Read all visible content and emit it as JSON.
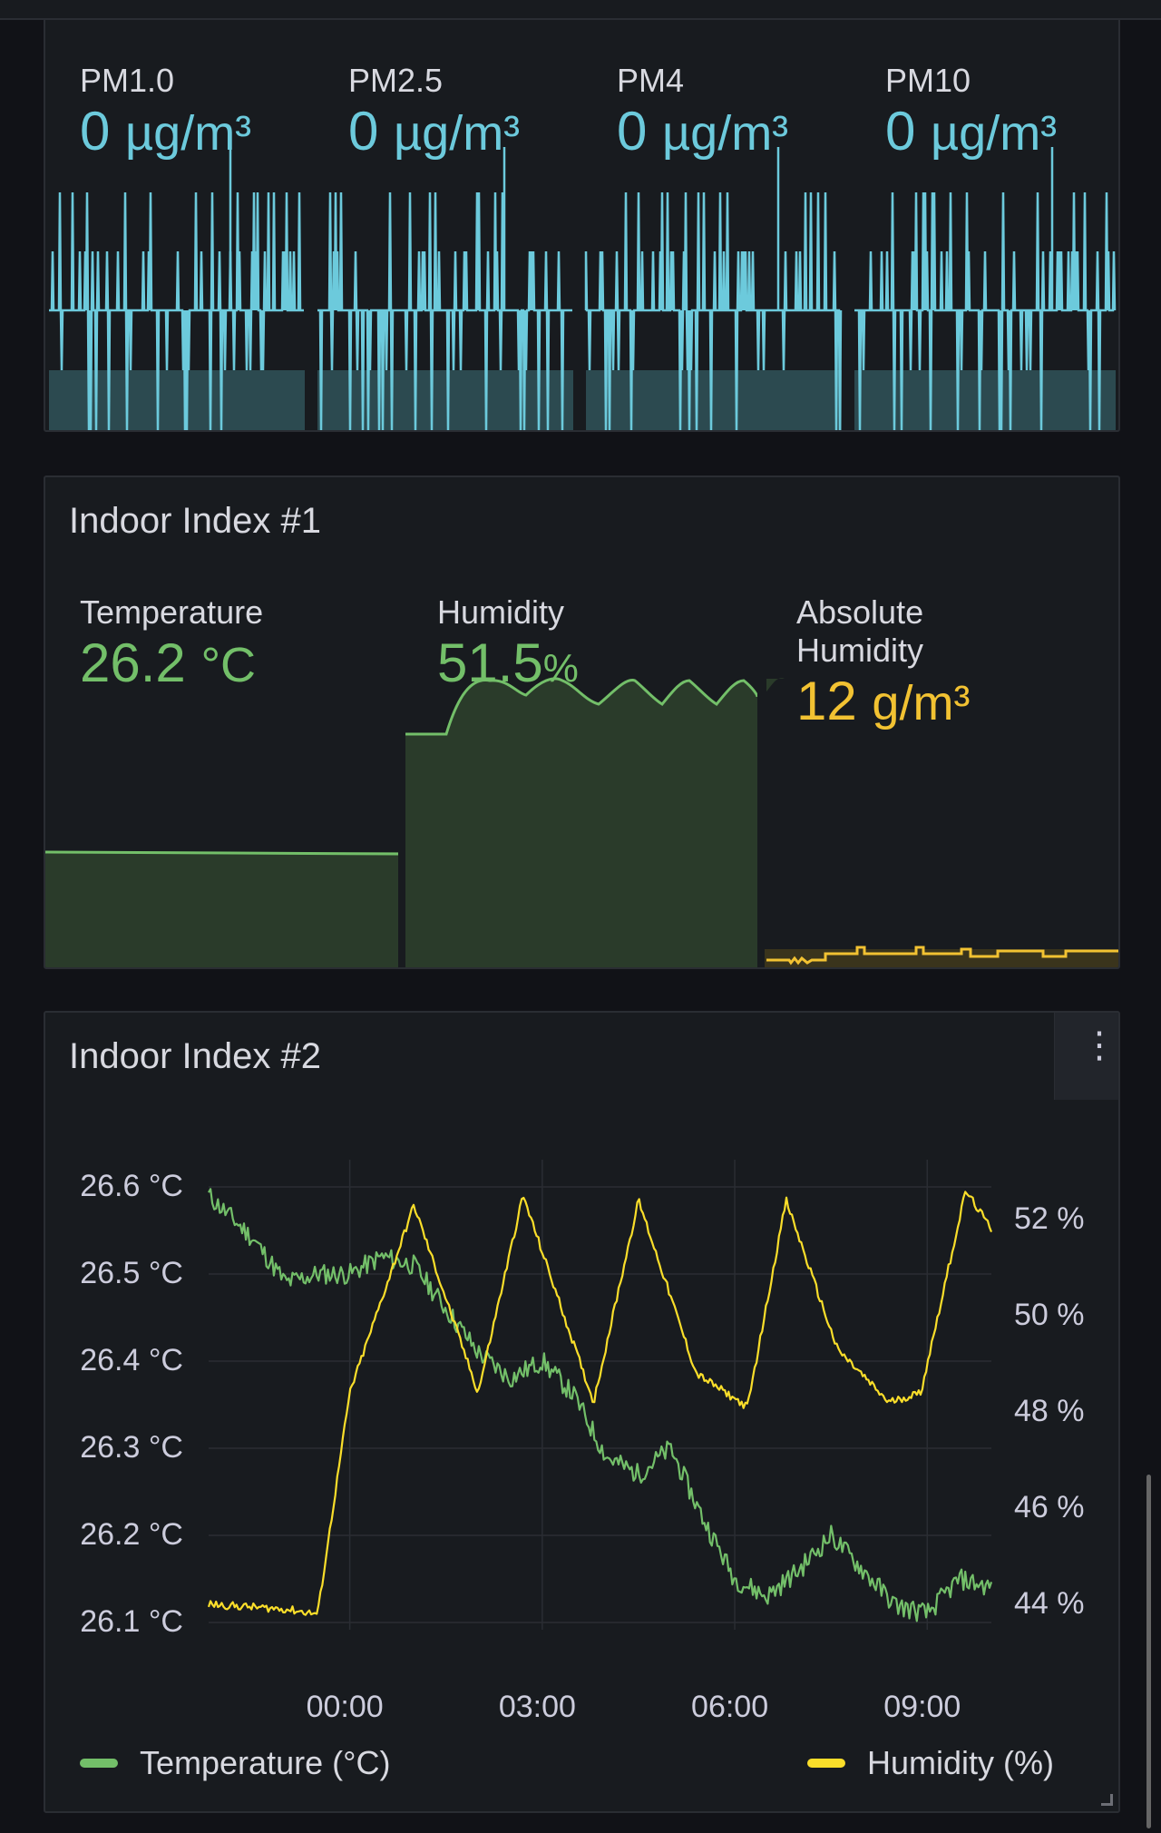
{
  "colors": {
    "pm": "#6ccadc",
    "temperature": "#73bf69",
    "humidity_stat": "#73bf69",
    "absolute_humidity": "#f2c232",
    "humidity_series": "#fade2a",
    "panel_bg": "#181b1f"
  },
  "pm_panel": {
    "stats": [
      {
        "label": "PM1.0",
        "value": "0",
        "unit": "µg/m³"
      },
      {
        "label": "PM2.5",
        "value": "0",
        "unit": "µg/m³"
      },
      {
        "label": "PM4",
        "value": "0",
        "unit": "µg/m³"
      },
      {
        "label": "PM10",
        "value": "0",
        "unit": "µg/m³"
      }
    ]
  },
  "indoor1": {
    "title": "Indoor Index #1",
    "temperature": {
      "label": "Temperature",
      "value": "26.2",
      "unit": "°C"
    },
    "humidity": {
      "label": "Humidity",
      "value": "51.5",
      "unit": "%"
    },
    "absolute": {
      "label_line1": "Absolute",
      "label_line2": "Humidity",
      "value": "12",
      "unit": "g/m³"
    }
  },
  "indoor2": {
    "title": "Indoor Index #2",
    "menu_icon": "vertical-ellipsis-icon",
    "legend": {
      "temperature": "Temperature (°C)",
      "humidity": "Humidity (%)"
    }
  },
  "chart_data": {
    "type": "line",
    "x_tick_labels": [
      "00:00",
      "03:00",
      "06:00",
      "09:00"
    ],
    "y_left": {
      "ticks": [
        "26.6 °C",
        "26.5 °C",
        "26.4 °C",
        "26.3 °C",
        "26.2 °C",
        "26.1 °C"
      ],
      "range": [
        26.1,
        26.6
      ]
    },
    "y_right": {
      "ticks": [
        "52 %",
        "50 %",
        "48 %",
        "46 %",
        "44 %"
      ],
      "range": [
        44,
        52
      ]
    },
    "x_range_hours": [
      -2.2,
      10.0
    ],
    "grid": true,
    "legend_placement": "bottom",
    "series": [
      {
        "name": "Temperature (°C)",
        "axis": "left",
        "x": [
          -2.2,
          -1.5,
          -1.0,
          -0.5,
          0.0,
          0.5,
          1.0,
          1.5,
          2.0,
          2.5,
          3.0,
          3.5,
          4.0,
          4.5,
          5.0,
          5.5,
          6.0,
          6.5,
          7.0,
          7.5,
          8.0,
          8.5,
          9.0,
          9.5,
          10.0
        ],
        "values": [
          26.59,
          26.54,
          26.49,
          26.5,
          26.5,
          26.52,
          26.51,
          26.46,
          26.41,
          26.38,
          26.4,
          26.36,
          26.29,
          26.27,
          26.3,
          26.22,
          26.15,
          26.13,
          26.16,
          26.2,
          26.16,
          26.12,
          26.11,
          26.15,
          26.14
        ]
      },
      {
        "name": "Humidity (%)",
        "axis": "right",
        "x": [
          -2.2,
          -1.0,
          -0.5,
          0.0,
          1.0,
          2.0,
          2.7,
          3.8,
          4.5,
          5.4,
          6.2,
          6.8,
          7.6,
          8.4,
          8.9,
          9.6,
          10.0
        ],
        "values": [
          44.0,
          43.9,
          43.8,
          48.4,
          52.3,
          48.4,
          52.5,
          48.2,
          52.4,
          48.8,
          48.1,
          52.4,
          49.3,
          48.2,
          48.4,
          52.6,
          51.8
        ]
      }
    ]
  }
}
